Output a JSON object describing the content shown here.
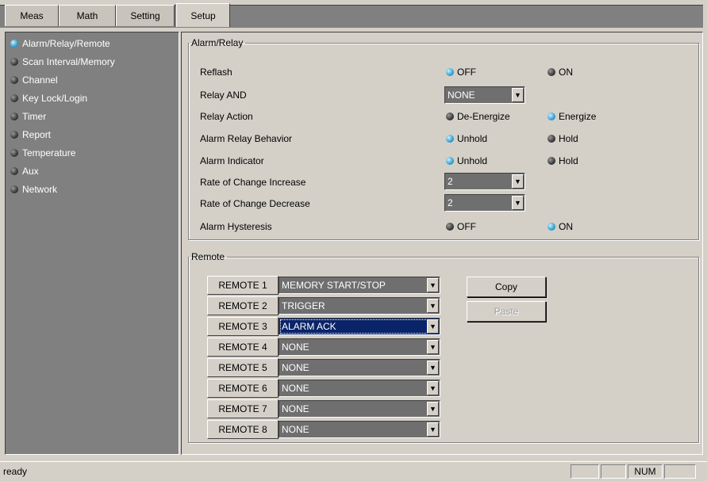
{
  "tabs": [
    {
      "label": "Meas",
      "active": false
    },
    {
      "label": "Math",
      "active": false
    },
    {
      "label": "Setting",
      "active": false
    },
    {
      "label": "Setup",
      "active": true
    }
  ],
  "sidebar": {
    "items": [
      {
        "label": "Alarm/Relay/Remote",
        "selected": true
      },
      {
        "label": "Scan Interval/Memory",
        "selected": false
      },
      {
        "label": "Channel",
        "selected": false
      },
      {
        "label": "Key Lock/Login",
        "selected": false
      },
      {
        "label": "Timer",
        "selected": false
      },
      {
        "label": "Report",
        "selected": false
      },
      {
        "label": "Temperature",
        "selected": false
      },
      {
        "label": "Aux",
        "selected": false
      },
      {
        "label": "Network",
        "selected": false
      }
    ]
  },
  "alarm_relay": {
    "title": "Alarm/Relay",
    "reflash": {
      "label": "Reflash",
      "options": [
        "OFF",
        "ON"
      ],
      "selected": "OFF"
    },
    "relay_and": {
      "label": "Relay AND",
      "value": "NONE"
    },
    "relay_action": {
      "label": "Relay Action",
      "options": [
        "De-Energize",
        "Energize"
      ],
      "selected": "Energize"
    },
    "alarm_relay_behavior": {
      "label": "Alarm Relay Behavior",
      "options": [
        "Unhold",
        "Hold"
      ],
      "selected": "Unhold"
    },
    "alarm_indicator": {
      "label": "Alarm Indicator",
      "options": [
        "Unhold",
        "Hold"
      ],
      "selected": "Unhold"
    },
    "roc_increase": {
      "label": "Rate of Change Increase",
      "value": "2"
    },
    "roc_decrease": {
      "label": "Rate of Change Decrease",
      "value": "2"
    },
    "alarm_hysteresis": {
      "label": "Alarm Hysteresis",
      "options": [
        "OFF",
        "ON"
      ],
      "selected": "ON"
    }
  },
  "remote": {
    "title": "Remote",
    "rows": [
      {
        "label": "REMOTE 1",
        "value": "MEMORY START/STOP"
      },
      {
        "label": "REMOTE 2",
        "value": "TRIGGER"
      },
      {
        "label": "REMOTE 3",
        "value": "ALARM ACK",
        "focused": true
      },
      {
        "label": "REMOTE 4",
        "value": "NONE"
      },
      {
        "label": "REMOTE 5",
        "value": "NONE"
      },
      {
        "label": "REMOTE 6",
        "value": "NONE"
      },
      {
        "label": "REMOTE 7",
        "value": "NONE"
      },
      {
        "label": "REMOTE 8",
        "value": "NONE"
      }
    ],
    "copy_label": "Copy",
    "paste_label": "Paste",
    "paste_enabled": false
  },
  "statusbar": {
    "status": "ready",
    "panes": [
      "",
      "",
      "NUM",
      ""
    ]
  },
  "icons": {
    "combo_arrow": "chevron-down-icon",
    "radio_selected": "radio-selected-icon",
    "radio_unselected": "radio-unselected-icon"
  },
  "colors": {
    "radio_selected": "#3aa7d6",
    "radio_unselected": "#3a3a3a",
    "focus_highlight": "#0a246a",
    "combo_bg": "#6f6f6f",
    "sidebar_bg": "#808080"
  }
}
